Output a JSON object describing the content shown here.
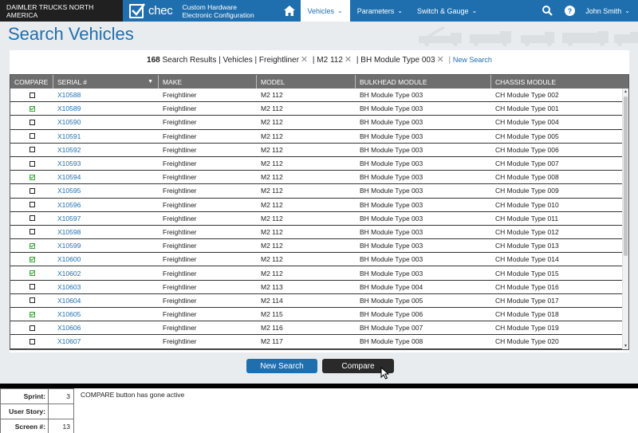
{
  "header": {
    "brand": "DAIMLER TRUCKS NORTH AMERICA",
    "logo_word": "chec",
    "app_name_line1": "Custom Hardware",
    "app_name_line2": "Electronic Configuration",
    "nav": [
      {
        "label": "Vehicles",
        "active": true
      },
      {
        "label": "Parameters",
        "active": false
      },
      {
        "label": "Switch & Gauge",
        "active": false
      }
    ],
    "user": "John Smith"
  },
  "page": {
    "title": "Search Vehicles"
  },
  "summary": {
    "count": "168",
    "results_label": "Search Results",
    "filter_prefix": "| Vehicles | ",
    "filters": [
      "Freightliner",
      "| M2 112",
      "| BH Module Type 003"
    ],
    "new_search_link": "New Search"
  },
  "grid": {
    "headers": [
      "COMPARE",
      "SERIAL #",
      "MAKE",
      "MODEL",
      "BULKHEAD MODULE",
      "CHASSIS MODULE"
    ],
    "rows": [
      {
        "checked": false,
        "serial": "X10588",
        "make": "Freightliner",
        "model": "M2 112",
        "bulkhead": "BH Module Type 003",
        "chassis": "CH Module Type 002"
      },
      {
        "checked": true,
        "serial": "X10589",
        "make": "Freightliner",
        "model": "M2 112",
        "bulkhead": "BH Module Type 003",
        "chassis": "CH Module Type 001"
      },
      {
        "checked": false,
        "serial": "X10590",
        "make": "Freightliner",
        "model": "M2 112",
        "bulkhead": "BH Module Type 003",
        "chassis": "CH Module Type 004"
      },
      {
        "checked": false,
        "serial": "X10591",
        "make": "Freightliner",
        "model": "M2 112",
        "bulkhead": "BH Module Type 003",
        "chassis": "CH Module Type 005"
      },
      {
        "checked": false,
        "serial": "X10592",
        "make": "Freightliner",
        "model": "M2 112",
        "bulkhead": "BH Module Type 003",
        "chassis": "CH Module Type 006"
      },
      {
        "checked": false,
        "serial": "X10593",
        "make": "Freightliner",
        "model": "M2 112",
        "bulkhead": "BH Module Type 003",
        "chassis": "CH Module Type 007"
      },
      {
        "checked": true,
        "serial": "X10594",
        "make": "Freightliner",
        "model": "M2 112",
        "bulkhead": "BH Module Type 003",
        "chassis": "CH Module Type 008"
      },
      {
        "checked": false,
        "serial": "X10595",
        "make": "Freightliner",
        "model": "M2 112",
        "bulkhead": "BH Module Type 003",
        "chassis": "CH Module Type 009"
      },
      {
        "checked": false,
        "serial": "X10596",
        "make": "Freightliner",
        "model": "M2 112",
        "bulkhead": "BH Module Type 003",
        "chassis": "CH Module Type 010"
      },
      {
        "checked": false,
        "serial": "X10597",
        "make": "Freightliner",
        "model": "M2 112",
        "bulkhead": "BH Module Type 003",
        "chassis": "CH Module Type 011"
      },
      {
        "checked": false,
        "serial": "X10598",
        "make": "Freightliner",
        "model": "M2 112",
        "bulkhead": "BH Module Type 003",
        "chassis": "CH Module Type 012"
      },
      {
        "checked": true,
        "serial": "X10599",
        "make": "Freightliner",
        "model": "M2 112",
        "bulkhead": "BH Module Type 003",
        "chassis": "CH Module Type 013"
      },
      {
        "checked": true,
        "serial": "X10600",
        "make": "Freightliner",
        "model": "M2 112",
        "bulkhead": "BH Module Type 003",
        "chassis": "CH Module Type 014"
      },
      {
        "checked": true,
        "serial": "X10602",
        "make": "Freightliner",
        "model": "M2 112",
        "bulkhead": "BH Module Type 003",
        "chassis": "CH Module Type 015"
      },
      {
        "checked": false,
        "serial": "X10603",
        "make": "Freightliner",
        "model": "M2 113",
        "bulkhead": "BH Module Type 004",
        "chassis": "CH Module Type 016"
      },
      {
        "checked": false,
        "serial": "X10604",
        "make": "Freightliner",
        "model": "M2 114",
        "bulkhead": "BH Module Type 005",
        "chassis": "CH Module Type 017"
      },
      {
        "checked": true,
        "serial": "X10605",
        "make": "Freightliner",
        "model": "M2 115",
        "bulkhead": "BH Module Type 006",
        "chassis": "CH Module Type 018"
      },
      {
        "checked": false,
        "serial": "X10606",
        "make": "Freightliner",
        "model": "M2 116",
        "bulkhead": "BH Module Type 007",
        "chassis": "CH Module Type 019"
      },
      {
        "checked": false,
        "serial": "X10607",
        "make": "Freightliner",
        "model": "M2 117",
        "bulkhead": "BH Module Type 008",
        "chassis": "CH Module Type 020"
      }
    ]
  },
  "buttons": {
    "new_search": "New Search",
    "compare": "Compare"
  },
  "notes": {
    "sprint_label": "Sprint:",
    "sprint_value": "3",
    "story_label": "User Story:",
    "story_value": "",
    "screen_label": "Screen #:",
    "screen_value": "13",
    "text": "COMPARE button has gone active"
  },
  "colors": {
    "primary": "#1f6fae",
    "check": "#3aa43a",
    "header_grey": "#6e6e6e"
  }
}
